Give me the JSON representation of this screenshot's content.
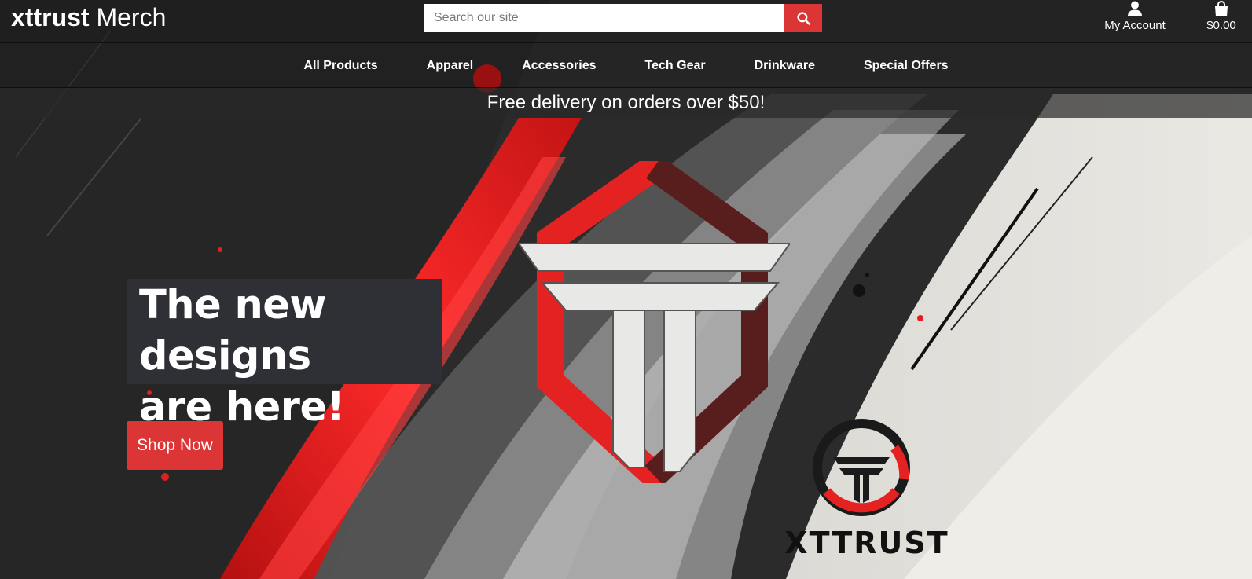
{
  "header": {
    "brand_bold": "xttrust",
    "brand_light": "Merch",
    "search_placeholder": "Search our site",
    "search_icon": "magnifier-icon",
    "account_label": "My Account",
    "account_icon": "user-icon",
    "cart_total": "$0.00",
    "cart_icon": "shopping-bag-icon"
  },
  "nav": {
    "items": [
      "All Products",
      "Apparel",
      "Accessories",
      "Tech Gear",
      "Drinkware",
      "Special Offers"
    ]
  },
  "banner": {
    "text": "Free delivery on orders over $50!"
  },
  "hero": {
    "headline_line1": "The new designs",
    "headline_line2": "are here!",
    "cta_label": "Shop Now",
    "wordmark": "XTTRUST"
  },
  "colors": {
    "accent_red": "#dc3535",
    "headline_bg": "#2e3035",
    "text": "#ffffff"
  }
}
